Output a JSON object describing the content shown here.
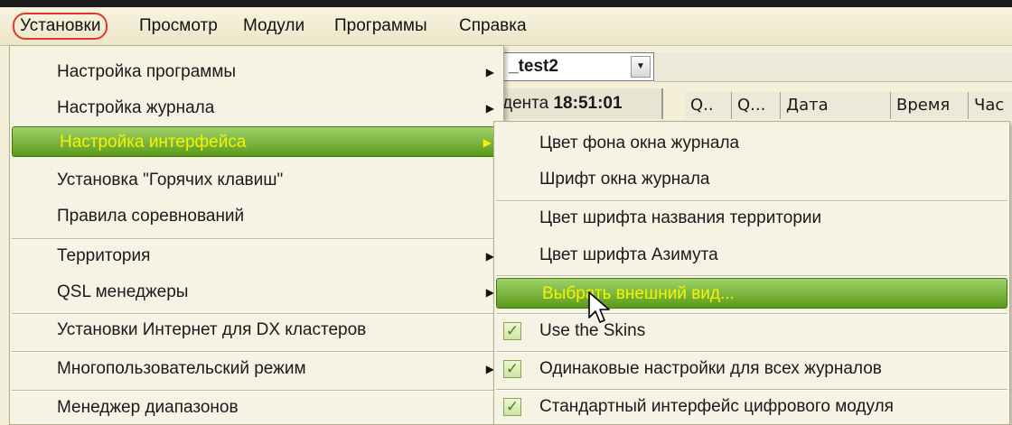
{
  "menubar": {
    "items": [
      "Установки",
      "Просмотр",
      "Модули",
      "Программы",
      "Справка"
    ]
  },
  "background": {
    "combo_value": "_test2",
    "time_prefix": "дента",
    "time_value": "18:51:01",
    "columns": [
      "Q..",
      "Q...",
      "Дата",
      "Время",
      "Час"
    ]
  },
  "menu_main": {
    "items": [
      {
        "label": "Настройка программы",
        "submenu": true
      },
      {
        "label": "Настройка журнала",
        "submenu": true
      },
      {
        "label": "Настройка интерфейса",
        "submenu": true,
        "highlighted": true
      },
      {
        "label": "Установка \"Горячих клавиш\""
      },
      {
        "label": "Правила соревнований"
      },
      {
        "label": "Территория",
        "submenu": true
      },
      {
        "label": "QSL менеджеры",
        "submenu": true
      },
      {
        "label": "Установки Интернет для DX кластеров"
      },
      {
        "label": "Многопользовательский режим",
        "submenu": true
      },
      {
        "label": "Менеджер диапазонов"
      }
    ]
  },
  "menu_interface": {
    "items": [
      {
        "label": "Цвет фона окна журнала"
      },
      {
        "label": "Шрифт окна журнала"
      },
      {
        "label": "Цвет шрифта названия территории"
      },
      {
        "label": "Цвет шрифта Азимута"
      },
      {
        "label": "Выбрать внешний вид...",
        "highlighted": true
      },
      {
        "label": "Use the Skins",
        "checked": true
      },
      {
        "label": "Одинаковые настройки для всех журналов",
        "checked": true
      },
      {
        "label": "Стандартный интерфейс цифрового модуля",
        "checked": true
      }
    ]
  },
  "colors": {
    "highlight_bg": "#6aa828",
    "highlight_text": "#f4f400",
    "active_ring": "#e0392b"
  }
}
